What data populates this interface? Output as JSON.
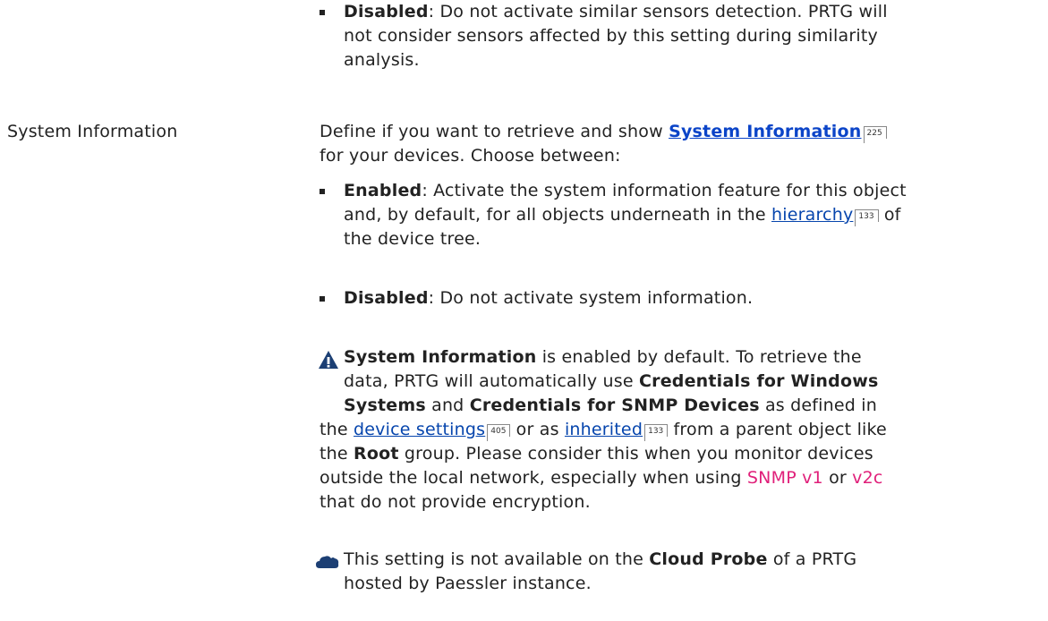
{
  "top": {
    "term": "Disabled",
    "text": ": Do not activate similar sensors detection. PRTG will",
    "line2": "not consider sensors affected by this setting during similarity",
    "line3": "analysis."
  },
  "setting": {
    "label": "System Information",
    "intro_a": "Define if you want to retrieve and show ",
    "link": "System Information",
    "link_page": "225",
    "intro_b": "for your devices. Choose between:"
  },
  "options": [
    {
      "term": "Enabled",
      "text": ": Activate the system information feature for this object",
      "line2_a": "and, by default, for all objects underneath in the ",
      "link": "hierarchy",
      "link_page": "133",
      "line2_b": " of",
      "line3": "the device tree."
    },
    {
      "term": "Disabled",
      "text": ": Do not activate system information."
    }
  ],
  "note": {
    "icon": "warning-icon",
    "b1": "System Information",
    "t1": " is enabled by default. To retrieve the",
    "t2": "data, PRTG will automatically use ",
    "b2": "Credentials for Windows",
    "b3": "Systems",
    "t3": " and ",
    "b4": "Credentials for SNMP Devices",
    "t4": " as defined in",
    "t5": "the ",
    "link1": "device settings",
    "link1_page": "405",
    "t6": " or as ",
    "link2": "inherited",
    "link2_page": "133",
    "t7": " from a parent object like",
    "t8": "the ",
    "b5": "Root",
    "t9": " group. Please consider this when you monitor devices",
    "t10": "outside the local network, especially when using ",
    "pink1": "SNMP v1",
    "t11": " or ",
    "pink2": "v2c",
    "t12": "that do not provide encryption."
  },
  "cloud_note": {
    "icon": "cloud-icon",
    "t1": "This setting is not available on the ",
    "b1": "Cloud Probe",
    "t2": " of a PRTG",
    "t3": "hosted by Paessler instance."
  },
  "colors": {
    "link": "#0645ad",
    "pink": "#e0207a",
    "warning": "#1c3f74",
    "cloud": "#1c3f74"
  }
}
